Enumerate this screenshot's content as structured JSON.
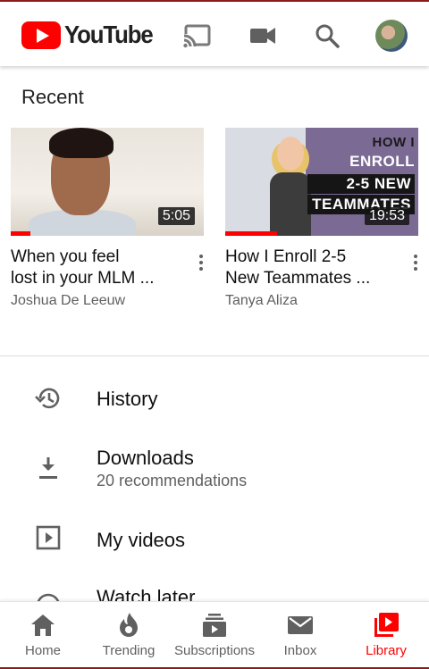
{
  "app": {
    "logo_text": "YouTube"
  },
  "header": {
    "icons": [
      "cast-icon",
      "video-camera-icon",
      "search-icon",
      "account-avatar"
    ]
  },
  "recent": {
    "title": "Recent",
    "videos": [
      {
        "title": "When you feel lost in your MLM ...",
        "line1": "When you feel",
        "line2": "lost in your MLM ...",
        "channel": "Joshua De Leeuw",
        "duration": "5:05",
        "watched": 0.1
      },
      {
        "title": "How I Enroll 2-5 New Teammates ...",
        "line1": "How I Enroll 2-5",
        "line2": "New Teammates ...",
        "channel": "Tanya Aliza",
        "duration": "19:53",
        "watched": 0.27,
        "thumb_text": [
          "HOW I",
          "ENROLL",
          "2-5 NEW",
          "TEAMMATES"
        ]
      }
    ]
  },
  "library": {
    "items": [
      {
        "label": "History",
        "icon": "history-icon"
      },
      {
        "label": "Downloads",
        "sub": "20 recommendations",
        "icon": "download-icon"
      },
      {
        "label": "My videos",
        "icon": "my-videos-icon"
      },
      {
        "label": "Watch later",
        "icon": "clock-icon"
      }
    ]
  },
  "nav": {
    "active": "Library",
    "items": [
      {
        "label": "Home",
        "icon": "home-icon"
      },
      {
        "label": "Trending",
        "icon": "flame-icon"
      },
      {
        "label": "Subscriptions",
        "icon": "subscriptions-icon"
      },
      {
        "label": "Inbox",
        "icon": "inbox-icon"
      },
      {
        "label": "Library",
        "icon": "library-icon"
      }
    ]
  },
  "colors": {
    "brand_red": "#ff0000",
    "text": "#0f0f0f",
    "secondary_text": "#606060"
  }
}
